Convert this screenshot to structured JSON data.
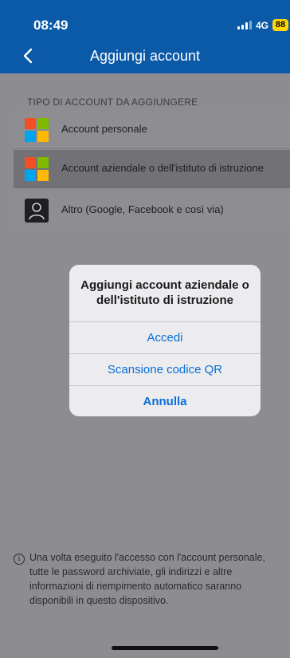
{
  "status": {
    "time": "08:49",
    "network": "4G",
    "battery": "88"
  },
  "nav": {
    "title": "Aggiungi account"
  },
  "section": {
    "header": "TIPO DI ACCOUNT DA AGGIUNGERE"
  },
  "accounts": [
    {
      "label": "Account personale",
      "icon": "microsoft-logo-icon"
    },
    {
      "label": "Account aziendale o dell'istituto di istruzione",
      "icon": "microsoft-logo-icon"
    },
    {
      "label": "Altro (Google, Facebook e così via)",
      "icon": "person-icon"
    }
  ],
  "dialog": {
    "title": "Aggiungi account aziendale o dell'istituto di istruzione",
    "buttons": [
      "Accedi",
      "Scansione codice QR",
      "Annulla"
    ]
  },
  "footer": {
    "text": "Una volta eseguito l'accesso con l'account personale, tutte le password archiviate, gli indirizzi e altre informazioni di riempimento automatico saranno disponibili in questo dispositivo."
  },
  "colors": {
    "header": "#0b5aa8",
    "accent": "#0a6ed8",
    "ms_red": "#f25022",
    "ms_green": "#7fba00",
    "ms_blue": "#00a4ef",
    "ms_yellow": "#ffb900"
  }
}
